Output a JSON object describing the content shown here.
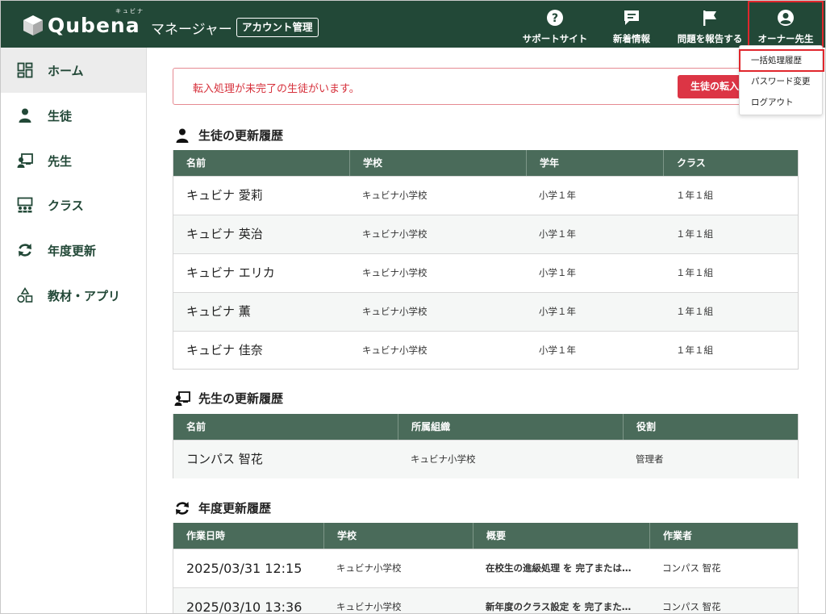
{
  "header": {
    "logo_text": "Qubena",
    "logo_ruby": "キュビナ",
    "app_name": "マネージャー",
    "account_badge": "アカウント管理",
    "nav": [
      {
        "label": "サポートサイト",
        "icon": "help-circle-icon"
      },
      {
        "label": "新着情報",
        "icon": "message-icon"
      },
      {
        "label": "問題を報告する",
        "icon": "flag-icon"
      },
      {
        "label": "オーナー先生",
        "icon": "user-circle-icon"
      }
    ]
  },
  "user_menu": {
    "items": [
      "一括処理履歴",
      "パスワード変更",
      "ログアウト"
    ]
  },
  "sidebar": {
    "items": [
      {
        "label": "ホーム",
        "icon": "dashboard-icon",
        "active": true
      },
      {
        "label": "生徒",
        "icon": "student-icon"
      },
      {
        "label": "先生",
        "icon": "teacher-icon"
      },
      {
        "label": "クラス",
        "icon": "class-icon"
      },
      {
        "label": "年度更新",
        "icon": "refresh-icon"
      },
      {
        "label": "教材・アプリ",
        "icon": "shapes-icon"
      }
    ]
  },
  "alert": {
    "message": "転入処理が未完了の生徒がいます。",
    "button": "生徒の転入"
  },
  "students": {
    "title": "生徒の更新履歴",
    "headers": [
      "名前",
      "学校",
      "学年",
      "クラス"
    ],
    "rows": [
      [
        "キュビナ 愛莉",
        "キュビナ小学校",
        "小学１年",
        "１年１組"
      ],
      [
        "キュビナ 英治",
        "キュビナ小学校",
        "小学１年",
        "１年１組"
      ],
      [
        "キュビナ エリカ",
        "キュビナ小学校",
        "小学１年",
        "１年１組"
      ],
      [
        "キュビナ 薫",
        "キュビナ小学校",
        "小学１年",
        "１年１組"
      ],
      [
        "キュビナ 佳奈",
        "キュビナ小学校",
        "小学１年",
        "１年１組"
      ]
    ]
  },
  "teachers": {
    "title": "先生の更新履歴",
    "headers": [
      "名前",
      "所属組織",
      "役割"
    ],
    "rows": [
      [
        "コンパス 智花",
        "キュビナ小学校",
        "管理者"
      ]
    ]
  },
  "year_update": {
    "title": "年度更新履歴",
    "headers": [
      "作業日時",
      "学校",
      "概要",
      "作業者"
    ],
    "rows": [
      {
        "datetime": "2025/03/31 12:15",
        "school": "キュビナ小学校",
        "summary_bold": "在校生の進級処理",
        "summary_rest": " を 完了または…",
        "worker": "コンパス 智花"
      },
      {
        "datetime": "2025/03/10 13:36",
        "school": "キュビナ小学校",
        "summary_bold": "新年度のクラス設定",
        "summary_rest": " を 完了また…",
        "worker": "コンパス 智花"
      }
    ]
  },
  "colors": {
    "header_bg": "#224837",
    "table_header_bg": "#4a6b5a",
    "alert_red": "#dc3545",
    "highlight_red": "#e0262c"
  }
}
